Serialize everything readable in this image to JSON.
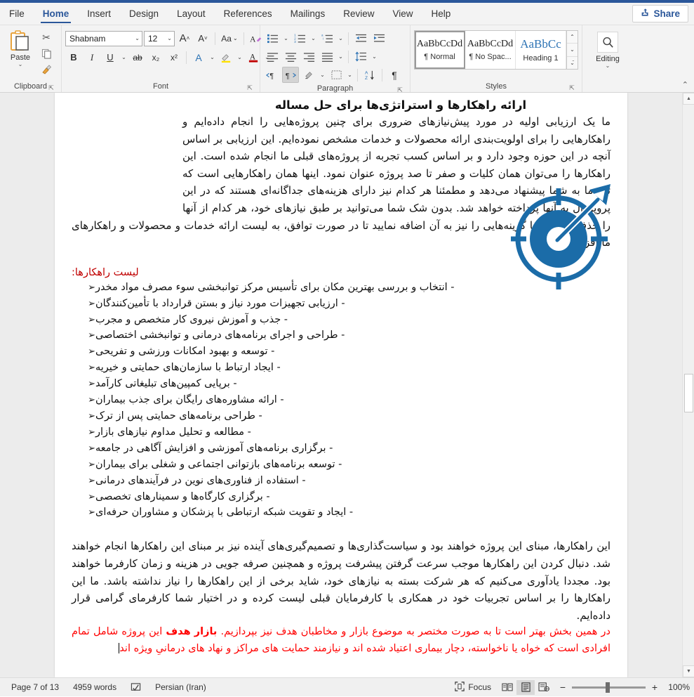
{
  "ribbon": {
    "tabs": [
      {
        "label": "File"
      },
      {
        "label": "Home"
      },
      {
        "label": "Insert"
      },
      {
        "label": "Design"
      },
      {
        "label": "Layout"
      },
      {
        "label": "References"
      },
      {
        "label": "Mailings"
      },
      {
        "label": "Review"
      },
      {
        "label": "View"
      },
      {
        "label": "Help"
      }
    ],
    "active_tab": "Home",
    "share_label": "Share",
    "share_icon": "share-icon",
    "collapse_icon": "chevron-up-icon",
    "groups": {
      "clipboard": {
        "label": "Clipboard",
        "paste_label": "Paste",
        "paste_icon": "paste-icon",
        "cut_icon": "scissors-icon",
        "copy_icon": "copy-icon",
        "format_painter_icon": "format-painter-icon",
        "launcher_icon": "dialog-launcher-icon"
      },
      "font": {
        "label": "Font",
        "font_family_value": "Shabnam",
        "font_size_value": "12",
        "grow_font_icon": "grow-font-icon",
        "shrink_font_icon": "shrink-font-icon",
        "change_case_icon": "change-case-icon",
        "clear_formatting_icon": "clear-formatting-icon",
        "bold_label": "B",
        "italic_label": "I",
        "underline_label": "U",
        "strikethrough_label": "ab",
        "subscript_label": "x₂",
        "superscript_label": "x²",
        "text_effects_icon": "text-effects-icon",
        "highlight_icon": "text-highlight-icon",
        "font_color_icon": "font-color-icon",
        "launcher_icon": "dialog-launcher-icon"
      },
      "paragraph": {
        "label": "Paragraph",
        "bullets_icon": "bullets-icon",
        "numbering_icon": "numbering-icon",
        "multilevel_icon": "multilevel-list-icon",
        "decrease_indent_icon": "decrease-indent-icon",
        "increase_indent_icon": "increase-indent-icon",
        "align_left_icon": "align-left-icon",
        "align_center_icon": "align-center-icon",
        "align_right_icon": "align-right-icon",
        "justify_icon": "justify-icon",
        "line_spacing_icon": "line-spacing-icon",
        "ltr_icon": "left-to-right-icon",
        "rtl_icon": "right-to-left-icon",
        "shading_icon": "shading-icon",
        "borders_icon": "borders-icon",
        "sort_icon": "sort-icon",
        "show_marks_icon": "show-formatting-marks-icon",
        "launcher_icon": "dialog-launcher-icon"
      },
      "styles": {
        "label": "Styles",
        "items": [
          {
            "preview": "AaBbCcDd",
            "name": "¶ Normal",
            "selected": true
          },
          {
            "preview": "AaBbCcDd",
            "name": "¶ No Spac...",
            "selected": false
          },
          {
            "preview": "AaBbCc",
            "name": "Heading 1",
            "selected": false
          }
        ],
        "scroll_up_icon": "chevron-up-icon",
        "scroll_down_icon": "chevron-down-icon",
        "more_icon": "more-styles-icon",
        "launcher_icon": "dialog-launcher-icon"
      },
      "editing": {
        "label": "Editing",
        "icon": "search-icon",
        "dropdown_icon": "chevron-down-icon"
      }
    }
  },
  "document": {
    "title": "ارائه راهکارها و استراتژی‌ها برای حل مساله",
    "decorative_icon": "target-with-arrow-icon",
    "icon_color": "#1B6CA8",
    "paragraph_1": "ما یک ارزیابی اولیه در مورد پیش‌نیازهای ضروری برای چنین پروژه‌هایی را انجام داده‌ایم و راهکارهایی را برای اولویت‌بندی ارائه محصولات و خدمات مشخص نموده‌ایم. این ارزیابی بر اساس آنچه در این حوزه وجود دارد و بر اساس کسب تجربه از پروژه‌های قبلی ما انجام شده است. این راهکارها را می‌توان همان کلیات و صفر تا صد پروژه عنوان نمود. اینها همان راهکارهایی است که تیم ما به شما پیشنهاد می‌دهد و مطمئنا هر کدام نیز دارای هزینه‌های جداگانه‌ای هستند که در این پروپوزال به آنها پرداخته خواهد شد. بدون شک شما می‌توانید بر طبق نیازهای خود، هر کدام از آنها را حذف نمایید و یا گزینه‌هایی را نیز به آن اضافه نمایید تا در صورت توافق، به لیست ارائه خدمات و محصولات و راهکارهای ما افزوده گردد.",
    "list_heading": "لیست راهکارها:",
    "list_heading_color": "#C00000",
    "bullet_glyph": "➢",
    "list_items": [
      "- انتخاب و بررسی بهترین مکان برای تأسیس مرکز توانبخشی سوء مصرف مواد مخدر",
      "- ارزیابی تجهیزات مورد نیاز و بستن قرارداد با تأمین‌کنندگان",
      "- جذب و آموزش نیروی کار متخصص و مجرب",
      "- طراحی و اجرای برنامه‌های درمانی و توانبخشی اختصاصی",
      "- توسعه و بهبود امکانات ورزشی و تفریحی",
      "- ایجاد ارتباط با سازمان‌های حمایتی و خیریه",
      "- برپایی کمپین‌های تبلیغاتی کارآمد",
      "- ارائه مشاوره‌های رایگان برای جذب بیماران",
      "- طراحی برنامه‌های حمایتی پس از ترک",
      "- مطالعه و تحلیل مداوم نیازهای بازار",
      "- برگزاری برنامه‌های آموزشی و افزایش آگاهی در جامعه",
      "- توسعه برنامه‌های بازتوانی اجتماعی و شغلی برای بیماران",
      "- استفاده از فناوری‌های نوین در فرآیندهای درمانی",
      "- برگزاری کارگاه‌ها و سمینارهای تخصصی",
      "- ایجاد و تقویت شبکه ارتباطی با پزشکان و مشاوران حرفه‌ای"
    ],
    "paragraph_2": "این راهکارها، مبنای این پروژه خواهند بود و سیاست‌گذاری‌ها و تصمیم‌گیری‌های آینده نیز بر مبنای این راهکارها انجام خواهند شد. دنبال کردن این راهکارها موجب سرعت گرفتن پیشرفت پروژه و همچنین صرفه جویی در هزینه و زمان کارفرما خواهند بود. مجددا یادآوری می‌کنیم که هر شرکت بسته به نیازهای خود، شاید برخی از این راهکارها را نیاز نداشته باشد. ما این راهکارها را بر اساس تجربیات خود در همکاری با کارفرمایان قبلی لیست کرده و در اختیار شما کارفرمای گرامی قرار داده‌ایم.",
    "red_paragraph_color": "#FF0000",
    "red_line_1_plain": "در همین بخش بهتر است تا به صورت مختصر به موضوع بازار و مخاطبان هدف نیز بپردازیم.",
    "red_bold_1": "بازار",
    "red_bold_2": "هدف",
    "red_line_2_plain": "این پروژه شامل تمام افرادی است که خواه یا ناخواسته، دچار بیماری اعتیاد شده اند و نیازمند حمایت های مراکز و نهاد های درمانیِ ویژه اند"
  },
  "scrollbar": {
    "up_arrow_icon": "scroll-up-arrow-icon",
    "down_arrow_icon": "scroll-down-arrow-icon",
    "thumb": "scroll-thumb"
  },
  "statusbar": {
    "page_info": "Page 7 of 13",
    "word_count": "4959 words",
    "proofing_icon": "proofing-errors-icon",
    "language": "Persian (Iran)",
    "focus_label": "Focus",
    "focus_icon": "focus-mode-icon",
    "read_mode_icon": "read-mode-icon",
    "print_layout_icon": "print-layout-icon",
    "web_layout_icon": "web-layout-icon",
    "zoom_out_label": "−",
    "zoom_in_label": "+",
    "zoom_value": "100%"
  }
}
